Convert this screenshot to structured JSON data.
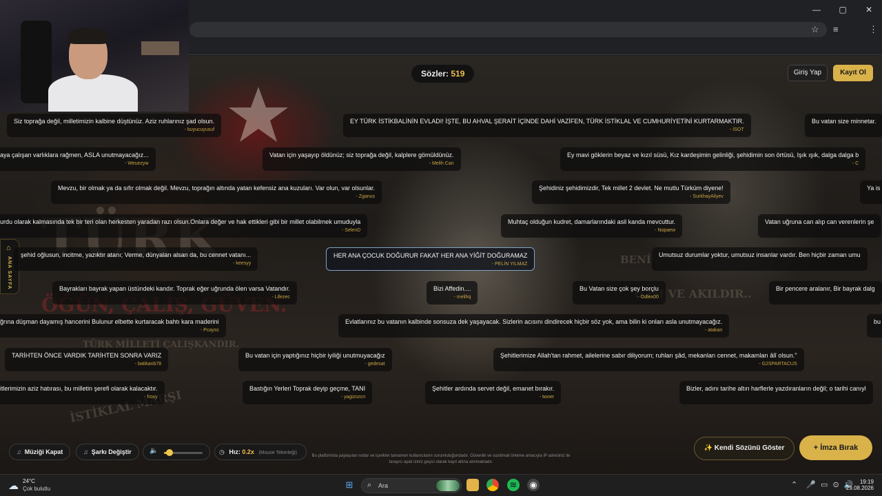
{
  "window_controls": {
    "minimize": "—",
    "maximize": "▢",
    "close": "✕"
  },
  "browser": {
    "profile_letter": "E"
  },
  "header": {
    "counter_label": "Sözler:",
    "counter_value": "519",
    "login": "Giriş Yap",
    "signup": "Kayıt Ol"
  },
  "sidebar_tab": {
    "label": "ANA SAYFA"
  },
  "bg_text": {
    "turk": "TÜRK",
    "motto": "ÖĞÜN, ÇALIŞ, GÜVEN.",
    "caliskan": "TÜRK MİLLETİ ÇALIŞKANDIR.",
    "marsi": "İSTİKLAL MARŞI",
    "ilim": "İLİM VE AKILDIR..",
    "beni": "BENİ"
  },
  "notes": [
    {
      "q": "Siz toprağa değil, milletimizin kalbine düştünüz. Aziz ruhlarınız şad olsun.",
      "a": "- buyucuyusuf"
    },
    {
      "q": "EY TÜRK İSTİKBALİNİN EVLADI! İŞTE, BU AHVAL ŞERAİT İÇİNDE DAHİ VAZİFEN, TÜRK İSTİKLAL VE CUMHURİYETİNİ KURTARMAKTIR.",
      "a": "- İSOT"
    },
    {
      "q": "Bu vatan size minnetar.",
      "a": ""
    },
    {
      "q": "aya çalışan varlıklara rağmen, ASLA unutmayacağız...",
      "a": "- Weuezyw"
    },
    {
      "q": "Vatan için yaşayıp öldünüz; siz toprağa değil, kalplere gömüldünüz.",
      "a": "- Melih Can"
    },
    {
      "q": "Ey mavi göklerin beyaz ve kızıl süsü, Kız kardeşimin gelinliği, şehidimin son örtüsü, Işık ışık, dalga dalga b",
      "a": "- C"
    },
    {
      "q": "Mevzu, bir olmak ya da sıfır olmak değil. Mevzu, toprağın altında yatan kefensiz ana kuzuları. Var olun, var olsunlar.",
      "a": "- Zganus"
    },
    {
      "q": "Şehidiniz şehidimizdir, Tek millet 2 devlet. Ne mutlu Türküm diyene!",
      "a": "- SurkhayAliyev"
    },
    {
      "q": "Ya is",
      "a": ""
    },
    {
      "q": "urdu olarak kalmasında tek bir teri olan herkesten yaradan razı olsun.Onlara değer ve hak ettikleri gibi bir millet olabilmek umuduyla",
      "a": "- SelenD"
    },
    {
      "q": "Muhtaç olduğun kudret, damarlarındaki asil kanda mevcuttur.",
      "a": "- Nopaew"
    },
    {
      "q": "Vatan uğruna can alıp can verenlerin şe",
      "a": ""
    },
    {
      "q": "şehid oğlusun, incitme, yazıktır atanı; Verme, dünyaları alsan da, bu cennet vatanı...",
      "a": "- keesyy"
    },
    {
      "q": "HER ANA ÇOCUK DOĞURUR FAKAT HER ANA YİĞİT DOĞURAMAZ",
      "a": "- PELİN YILMAZ"
    },
    {
      "q": "Umutsuz durumlar yoktur, umutsuz insanlar vardır. Ben hiçbir zaman umu",
      "a": ""
    },
    {
      "q": "Bayrakları bayrak yapan üstündeki kandır. Toprak eğer uğrunda ölen varsa Vatandır.",
      "a": "- Lifezec"
    },
    {
      "q": "Bizi Affedin....",
      "a": "- melihq"
    },
    {
      "q": "Bu Vatan size çok şey borçlu",
      "a": "- Odlex00"
    },
    {
      "q": "Bir pencere aralanır, Bir bayrak dalg",
      "a": ""
    },
    {
      "q": "ğrına düşman dayamış hancerini Bulunur elbette kurtaracak bahtı kara maderini",
      "a": "- Pcayss"
    },
    {
      "q": "Evlatlarınız bu vatanın kalbinde sonsuza dek yaşayacak. Sizlerin acısını dindirecek hiçbir söz yok, ama bilin ki onları asla unutmayacağız.",
      "a": "- atakan"
    },
    {
      "q": "bu",
      "a": ""
    },
    {
      "q": "TARİHTEN ÖNCE VARDIK TARİHTEN SONRA VARIZ",
      "a": "- batikanb78"
    },
    {
      "q": "Bu vatan için yaptığınız hiçbir iyiliği unutmuyacağız",
      "a": "- gedesat"
    },
    {
      "q": "Şehitlerimize Allah'tan rahmet, ailelerine sabır diliyorum; ruhları şâd, mekanları cennet, makamları âlî olsun.\"",
      "a": "- G2SPARTACUS"
    },
    {
      "q": "itlerimizin aziz hatırası, bu milletin şerefi olarak kalacaktır.",
      "a": "- froxy"
    },
    {
      "q": "Bastığın Yerleri Toprak deyip geçme, TANI",
      "a": "- yagizozcn"
    },
    {
      "q": "Şehitler ardında servet değil, emanet bırakır.",
      "a": "- twoer"
    },
    {
      "q": "Bizler, adını tarihe altın harflerle yazdıranların değil; o tarihi canıyl",
      "a": ""
    }
  ],
  "controls": {
    "music_off": "Müziği Kapat",
    "change_song": "Şarkı Değiştir",
    "volume_level": 0.15,
    "speed_label": "Hız:",
    "speed_value": "0.2x",
    "speed_hint": "(Mouse Tekerleği)",
    "show_own": "✨ Kendi Sözünü Göster",
    "sign": "+ İmza Bırak"
  },
  "footer_note": "Bu platformda paylaşılan notlar ve içerikler tamamen kullanıcıların sorumluluğundadır. Güvenlik ve suistimali önleme amacıyla IP adresiniz ile tarayıcı ayak iziniz geçici olarak kayıt altına alınmaktadır.",
  "taskbar": {
    "temp": "24°C",
    "condition": "Çok bulutlu",
    "search_placeholder": "Ara",
    "time": "19:19",
    "date": "29.08.2026"
  }
}
